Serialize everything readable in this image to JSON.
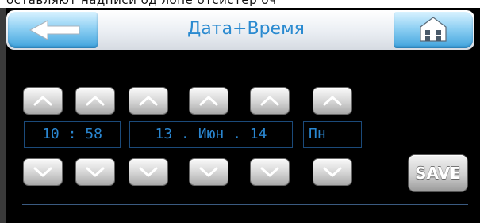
{
  "header": {
    "title": "Дата+Время",
    "back_icon": "back-arrow-icon",
    "home_icon": "home-icon"
  },
  "top_strip_text": "оставляют надписи од лопе отсистер оч",
  "time_value": "10 : 58",
  "date_value": "13 . Июн . 14",
  "weekday_value": "Пн",
  "save_label": "SAVE",
  "colors": {
    "accent": "#2a8ad0",
    "background": "#000000",
    "header_bg": "#eef2f6",
    "button_blue": "#3fa3dd"
  },
  "arrow_icons": {
    "up": "chevron-up-icon",
    "down": "chevron-down-icon"
  }
}
